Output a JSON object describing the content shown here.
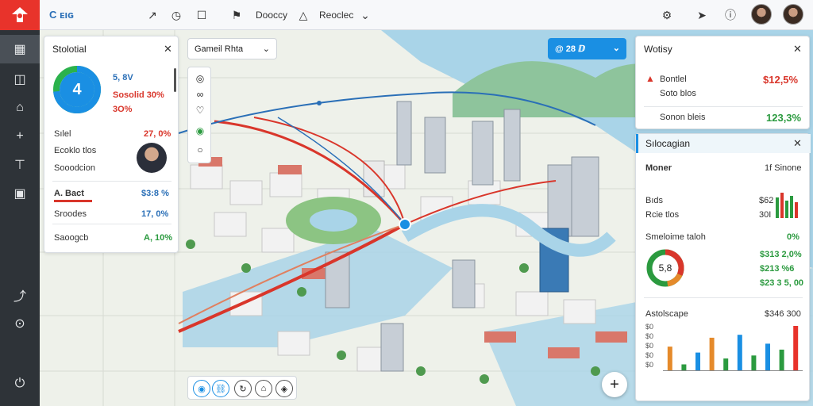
{
  "topbar": {
    "brand": "C ᴇıɢ",
    "menu_1_label": "Dooccy",
    "menu_2_label": "Reoclec"
  },
  "left_panel": {
    "title": "Stolotial",
    "donut_value": "4",
    "stat_1": "5, 8V",
    "stat_2": "Sosolid 30%",
    "stat_3": "3O%",
    "item_1_label": "Sılel",
    "item_1_value": "27, 0%",
    "item_2_label": "Ecoklo tlos",
    "item_3_label": "Sooodcion",
    "item_4_label": "A. Bact",
    "item_4_value": "$3:8 %",
    "item_5_label": "Sroodes",
    "item_5_value": "17, 0%",
    "item_6_label": "Saoogcb",
    "item_6_value": "A, 10%"
  },
  "search": {
    "placeholder": "Gameil Rhta"
  },
  "blue_button": {
    "label": "@ 28 ⅅ"
  },
  "right_panel_top": {
    "title": "Wotisy",
    "row_1_label": "Bontlel",
    "row_1_value": "$12,5%",
    "row_2_label": "Soto blos",
    "row_3_label": "Sonon bleis",
    "row_3_value": "123,3%"
  },
  "right_panel_bottom": {
    "title": "Sılocagian",
    "h_label": "Moner",
    "h_value": "1f Sinone",
    "sub_1": "Bıds",
    "sub_1_value": "$62",
    "sub_2": "Rcie tlos",
    "sub_2_value": "30I",
    "donut_title": "Smeloime taloh",
    "donut_pct": "0%",
    "donut_value": "5,8",
    "v1": "$313 2,0%",
    "v2": "$213 %6",
    "v3": "$23 3 5, 00",
    "chart_title": "Astolscape",
    "chart_value": "$346 300",
    "y_ticks": [
      "$0",
      "$0",
      "$0",
      "$0",
      "$0"
    ]
  },
  "colors": {
    "accent": "#1a8fe3",
    "brand_red": "#e8332b",
    "route": "#d9362b",
    "water": "#a9d4e8"
  },
  "chart_data": {
    "type": "bar",
    "series": [
      {
        "values": [
          40,
          10,
          30,
          55,
          20,
          60,
          25,
          45,
          35,
          75
        ]
      }
    ]
  }
}
